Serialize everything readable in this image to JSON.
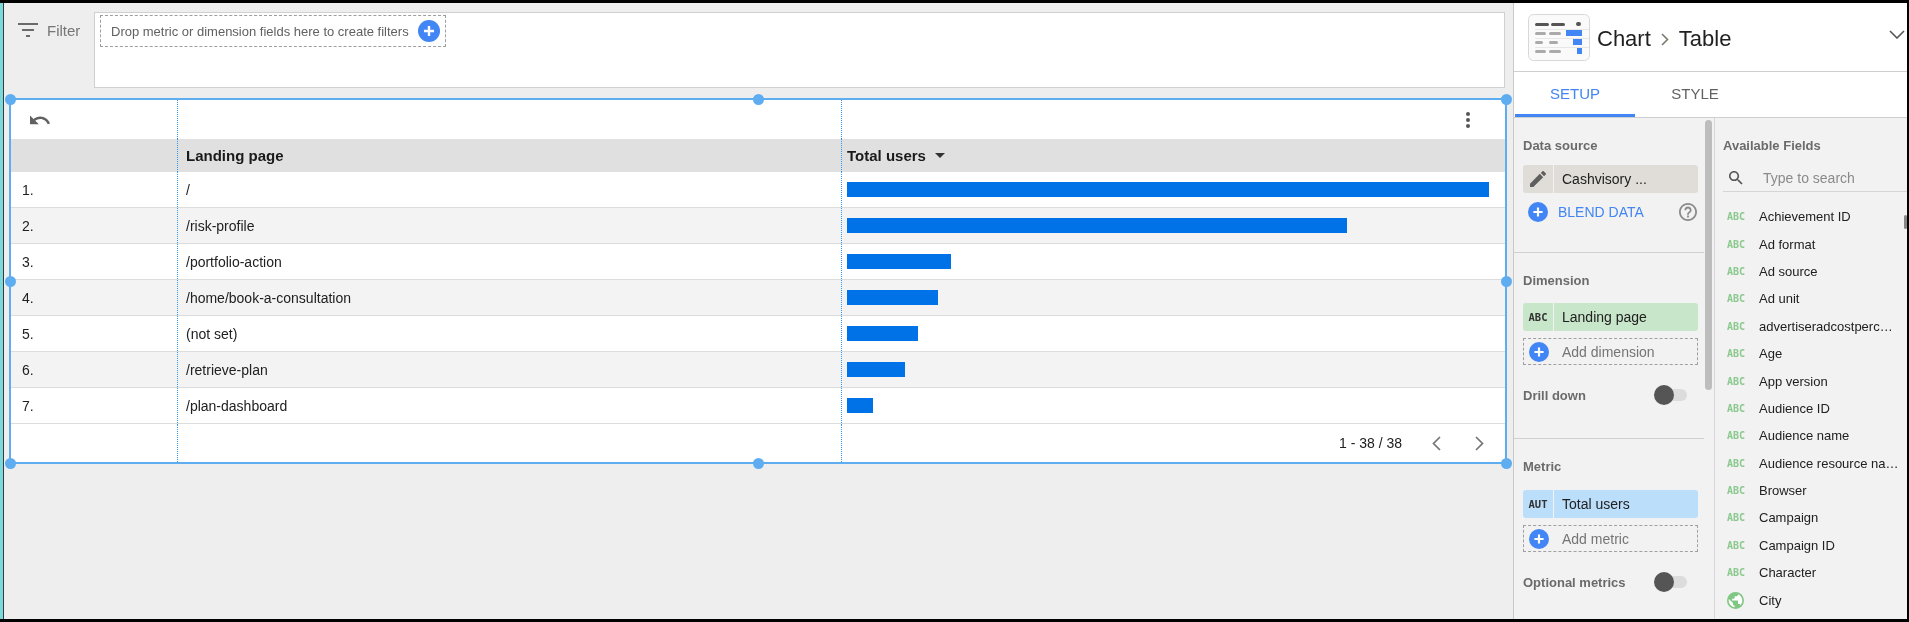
{
  "filter_bar": {
    "label": "Filter",
    "drop_zone": {
      "hint": "Drop metric or dimension fields here to create filters"
    }
  },
  "table": {
    "selected": true,
    "columns": [
      {
        "label": "Landing page",
        "sorted": false
      },
      {
        "label": "Total users",
        "sorted": true
      }
    ],
    "rows": [
      {
        "index": "1.",
        "landing_page": "/",
        "level": 1
      },
      {
        "index": "2.",
        "landing_page": "/risk-profile",
        "level": 0.779
      },
      {
        "index": "3.",
        "landing_page": "/portfolio-action",
        "level": 0.162
      },
      {
        "index": "4.",
        "landing_page": "/home/book-a-consultation",
        "level": 0.141
      },
      {
        "index": "5.",
        "landing_page": "(not set)",
        "level": 0.11
      },
      {
        "index": "6.",
        "landing_page": "/retrieve-plan",
        "level": 0.091
      },
      {
        "index": "7.",
        "landing_page": "/plan-dashboard",
        "level": 0.04
      }
    ],
    "pagination": "1 - 38 / 38"
  },
  "panel": {
    "breadcrumb": [
      "Chart",
      "Table"
    ],
    "tabs": [
      {
        "label": "SETUP",
        "selected": true
      },
      {
        "label": "STYLE",
        "selected": false
      }
    ],
    "data_source": {
      "heading": "Data source",
      "name": "Cashvisory ...",
      "blend_label": "BLEND DATA"
    },
    "dimension": {
      "heading": "Dimension",
      "fields": [
        {
          "type_label": "ABC",
          "name": "Landing page"
        }
      ],
      "add_label": "Add dimension"
    },
    "drill_down": {
      "label": "Drill down",
      "on": false
    },
    "metric": {
      "heading": "Metric",
      "fields": [
        {
          "type_label": "AUT",
          "name": "Total users"
        }
      ],
      "add_label": "Add metric"
    },
    "optional_metrics": {
      "label": "Optional metrics",
      "on": false
    },
    "available_fields": {
      "heading": "Available Fields",
      "search": {
        "placeholder": "Type to search"
      },
      "fields": [
        {
          "kind": "text",
          "type_label": "ABC",
          "name": "Achievement ID"
        },
        {
          "kind": "text",
          "type_label": "ABC",
          "name": "Ad format"
        },
        {
          "kind": "text",
          "type_label": "ABC",
          "name": "Ad source"
        },
        {
          "kind": "text",
          "type_label": "ABC",
          "name": "Ad unit"
        },
        {
          "kind": "text",
          "type_label": "ABC",
          "name": "advertiseradcostperc…"
        },
        {
          "kind": "text",
          "type_label": "ABC",
          "name": "Age"
        },
        {
          "kind": "text",
          "type_label": "ABC",
          "name": "App version"
        },
        {
          "kind": "text",
          "type_label": "ABC",
          "name": "Audience ID"
        },
        {
          "kind": "text",
          "type_label": "ABC",
          "name": "Audience name"
        },
        {
          "kind": "text",
          "type_label": "ABC",
          "name": "Audience resource na…"
        },
        {
          "kind": "text",
          "type_label": "ABC",
          "name": "Browser"
        },
        {
          "kind": "text",
          "type_label": "ABC",
          "name": "Campaign"
        },
        {
          "kind": "text",
          "type_label": "ABC",
          "name": "Campaign ID"
        },
        {
          "kind": "text",
          "type_label": "ABC",
          "name": "Character"
        },
        {
          "kind": "geo",
          "name": "City"
        }
      ]
    }
  }
}
